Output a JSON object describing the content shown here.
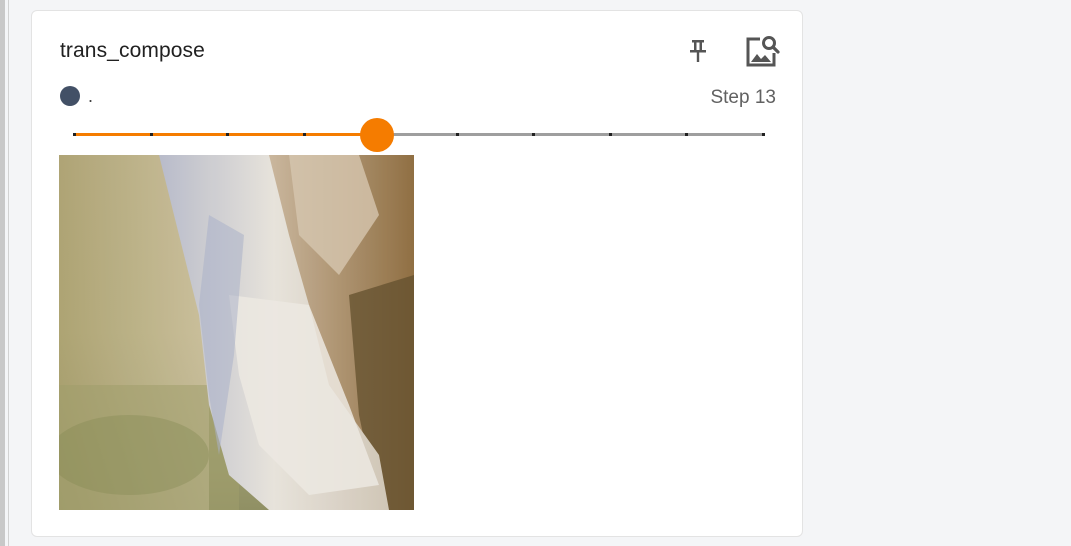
{
  "card": {
    "title": "trans_compose",
    "run_name": ".",
    "run_color": "#425066",
    "step_prefix": "Step",
    "step_value": 13,
    "pin_icon": "pin-icon",
    "expand_icon": "image-search-icon"
  },
  "slider": {
    "fill_fraction": 0.44,
    "tick_count": 10,
    "accent_color": "#f57c00"
  },
  "image": {
    "description_icon": "image-sample"
  }
}
